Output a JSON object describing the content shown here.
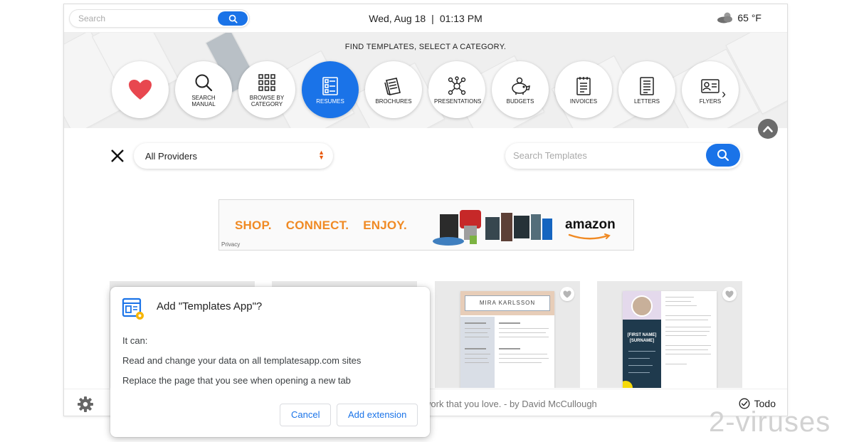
{
  "topbar": {
    "search_placeholder": "Search",
    "date": "Wed, Aug 18",
    "separator": "|",
    "time": "01:13 PM",
    "temperature": "65 °F",
    "weather_icon": "partly-cloudy-icon"
  },
  "hero": {
    "title": "FIND TEMPLATES, SELECT A CATEGORY.",
    "categories": [
      {
        "label": "",
        "icon": "heart-icon",
        "active": false
      },
      {
        "label": "SEARCH MANUAL",
        "icon": "search-icon",
        "active": false
      },
      {
        "label": "BROWSE BY CATEGORY",
        "icon": "grid-icon",
        "active": false
      },
      {
        "label": "RESUMES",
        "icon": "resume-icon",
        "active": true
      },
      {
        "label": "BROCHURES",
        "icon": "brochure-icon",
        "active": false
      },
      {
        "label": "PRESENTATIONS",
        "icon": "network-icon",
        "active": false
      },
      {
        "label": "BUDGETS",
        "icon": "piggy-bank-icon",
        "active": false
      },
      {
        "label": "INVOICES",
        "icon": "invoice-icon",
        "active": false
      },
      {
        "label": "LETTERS",
        "icon": "letter-icon",
        "active": false
      },
      {
        "label": "FLYERS",
        "icon": "flyer-icon",
        "active": false
      }
    ],
    "next_arrow": "›"
  },
  "filters": {
    "provider": "All Providers",
    "search_placeholder": "Search Templates"
  },
  "ad": {
    "slogan": [
      "SHOP.",
      "CONNECT.",
      "ENJOY."
    ],
    "brand": "amazon",
    "privacy": "Privacy"
  },
  "templates": [
    {
      "name": "MIRA KARLSSON"
    },
    {
      "name": "[FIRST NAME] [SURNAME]"
    }
  ],
  "bottombar": {
    "quote": "work that you love. - by David McCullough",
    "todo": "Todo"
  },
  "dialog": {
    "title": "Add \"Templates App\"?",
    "intro": "It can:",
    "permissions": [
      "Read and change your data on all templatesapp.com sites",
      "Replace the page that you see when opening a new tab"
    ],
    "cancel": "Cancel",
    "add": "Add extension"
  },
  "watermark": "2-viruses",
  "colors": {
    "accent": "#1a73e8",
    "heart": "#e8474f",
    "ad_orange": "#f08a24"
  }
}
